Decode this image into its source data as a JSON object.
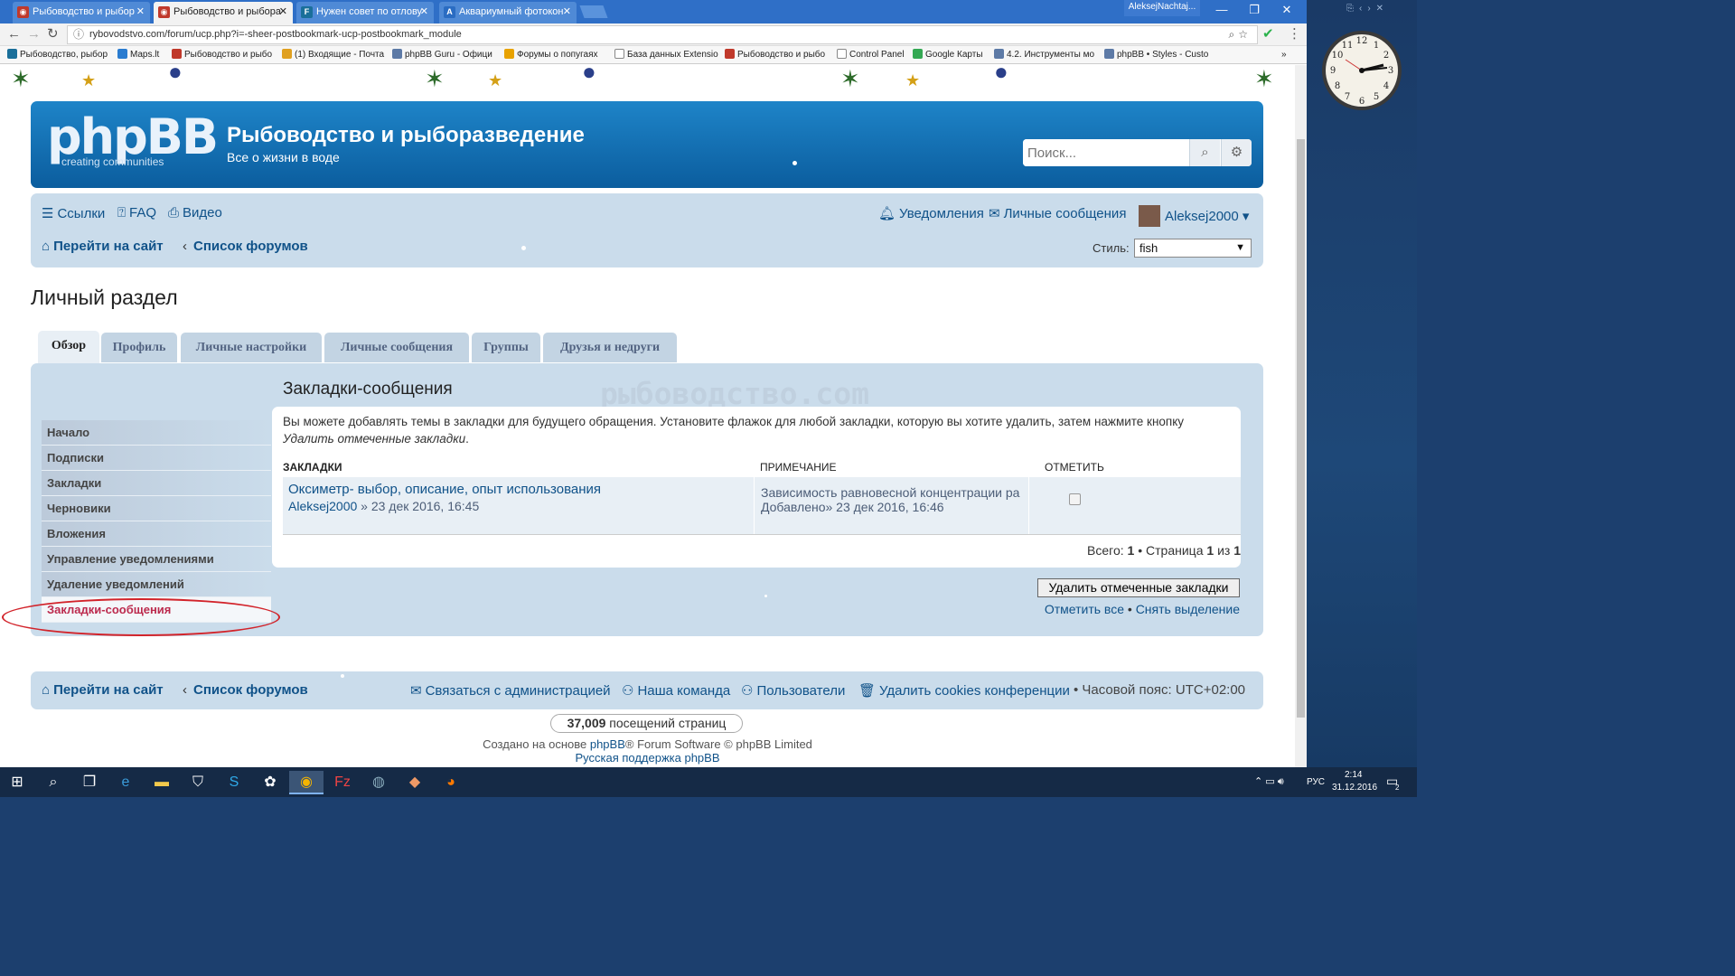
{
  "browser": {
    "tabs": [
      {
        "title": "Рыбоводство и рыбор",
        "favicon_color": "#c0392b",
        "active": false
      },
      {
        "title": "Рыбоводство и рыбора",
        "favicon_color": "#c0392b",
        "active": true
      },
      {
        "title": "Нужен совет по отлову",
        "favicon_color": "#1a6f9a",
        "active": false
      },
      {
        "title": "Аквариумный фотокон",
        "favicon_color": "#2a6cc2",
        "active": false
      }
    ],
    "profile_name": "AleksejNachtaj...",
    "url": "rybovodstvo.com/forum/ucp.php?i=-sheer-postbookmark-ucp-postbookmark_module",
    "bookmarks": [
      "Рыбоводство, рыбор",
      "Maps.lt",
      "Рыбоводство и рыбо",
      "(1) Входящие - Почта",
      "phpBB Guru - Офици",
      "Форумы о попугаях",
      "База данных Extensio",
      "Рыбоводство и рыбо",
      "Control Panel",
      "Google Карты",
      "4.2. Инструменты мо",
      "phpBB • Styles - Custo"
    ]
  },
  "site": {
    "logo_text": "phpBB",
    "logo_sub": "creating communities",
    "title": "Рыбоводство и рыборазведение",
    "description": "Все о жизни в воде",
    "search_placeholder": "Поиск..."
  },
  "navbar": {
    "links": "Ссылки",
    "faq": "FAQ",
    "video": "Видео",
    "notifications": "Уведомления",
    "private_messages": "Личные сообщения",
    "username": "Aleksej2000",
    "go_to_site": "Перейти на сайт",
    "board_index": "Список форумов",
    "style_label": "Стиль:",
    "style_value": "fish"
  },
  "page": {
    "title": "Личный раздел",
    "tabs": [
      "Обзор",
      "Профиль",
      "Личные настройки",
      "Личные сообщения",
      "Группы",
      "Друзья и недруги"
    ],
    "menu": [
      "Начало",
      "Подписки",
      "Закладки",
      "Черновики",
      "Вложения",
      "Управление уведомлениями",
      "Удаление уведомлений",
      "Закладки-сообщения"
    ],
    "section_title": "Закладки-сообщения",
    "watermark": "рыбоводство.com",
    "desc_text": "Вы можете добавлять темы в закладки для будущего обращения. Установите флажок для любой закладки, которую вы хотите удалить, затем нажмите кнопку ",
    "desc_italic": "Удалить отмеченные закладки",
    "desc_end": ".",
    "col_bookmarks": "ЗАКЛАДКИ",
    "col_note": "ПРИМЕЧАНИЕ",
    "col_mark": "ОТМЕТИТЬ",
    "row": {
      "topic": "Оксиметр- выбор, описание, опыт использования",
      "author": "Aleksej2000",
      "date": "» 23 дек 2016, 16:45",
      "note": "Зависимость равновесной концентрации ра",
      "added": "Добавлено» 23 дек 2016, 16:46"
    },
    "total_label": "Всего:",
    "total": "1",
    "page_label": "• Страница",
    "page_num": "1",
    "of_label": "из",
    "page_total": "1",
    "delete_button": "Удалить отмеченные закладки",
    "mark_all": "Отметить все",
    "unmark_all": "Снять выделение"
  },
  "footer": {
    "go_to_site": "Перейти на сайт",
    "board_index": "Список форумов",
    "contact": "Связаться с администрацией",
    "team": "Наша команда",
    "members": "Пользователи",
    "delete_cookies": "Удалить cookies конференции",
    "timezone": "• Часовой пояс:",
    "timezone_value": "UTC+02:00",
    "page_views": "37,009",
    "page_views_label": "посещений страниц",
    "credit_prefix": "Создано на основе",
    "credit_link": "phpBB",
    "credit_suffix": "® Forum Software © phpBB Limited",
    "russian_support": "Русская поддержка phpBB"
  },
  "taskbar": {
    "language": "РУС",
    "time": "2:14",
    "date": "31.12.2016",
    "notification_count": "2"
  },
  "colors": {
    "header_blue": "#0b5d9e",
    "link_blue": "#105289",
    "active_menu_red": "#bc2a4d",
    "annotation_red": "#d2232a"
  }
}
